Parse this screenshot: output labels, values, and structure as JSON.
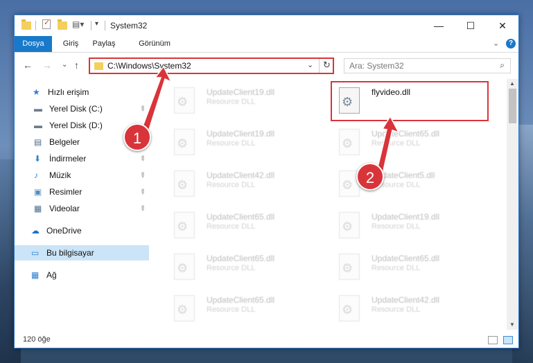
{
  "window": {
    "title": "System32",
    "controls": {
      "minimize": "—",
      "maximize": "☐",
      "close": "✕"
    }
  },
  "ribbon": {
    "tabs": [
      "Dosya",
      "Giriş",
      "Paylaş",
      "Görünüm"
    ],
    "expand_icon": "⌄",
    "help": "?"
  },
  "nav": {
    "back": "←",
    "forward": "→",
    "recent": "⌄",
    "up": "↑",
    "address": "C:\\Windows\\System32",
    "address_dropdown": "⌄",
    "refresh": "↻",
    "search_placeholder": "Ara: System32",
    "search_icon": "⌕"
  },
  "sidebar": {
    "items": [
      {
        "label": "Hızlı erişim",
        "icon": "star-icon",
        "glyph": "★",
        "color": "#2f7fd3"
      },
      {
        "label": "Yerel Disk (C:)",
        "icon": "drive-icon",
        "glyph": "▬",
        "color": "#6b7c8d",
        "pinned": true
      },
      {
        "label": "Yerel Disk (D:)",
        "icon": "drive-icon",
        "glyph": "▬",
        "color": "#6b7c8d"
      },
      {
        "label": "Belgeler",
        "icon": "documents-icon",
        "glyph": "▤",
        "color": "#4f6f8f",
        "pinned": true
      },
      {
        "label": "İndirmeler",
        "icon": "downloads-icon",
        "glyph": "⬇",
        "color": "#2f7fd3",
        "pinned": true
      },
      {
        "label": "Müzik",
        "icon": "music-icon",
        "glyph": "♪",
        "color": "#2f7fd3",
        "pinned": true
      },
      {
        "label": "Resimler",
        "icon": "pictures-icon",
        "glyph": "▣",
        "color": "#4f8fbf",
        "pinned": true
      },
      {
        "label": "Videolar",
        "icon": "videos-icon",
        "glyph": "▦",
        "color": "#4f6f8f",
        "pinned": true
      },
      {
        "label": "OneDrive",
        "icon": "onedrive-icon",
        "glyph": "☁",
        "color": "#1c6fc4"
      },
      {
        "label": "Bu bilgisayar",
        "icon": "computer-icon",
        "glyph": "▭",
        "color": "#2f7fd3",
        "selected": true
      },
      {
        "label": "Ağ",
        "icon": "network-icon",
        "glyph": "▦",
        "color": "#2f7fd3"
      }
    ],
    "pin_glyph": "📌"
  },
  "files": {
    "left": [
      {
        "name": "UpdateClient19.dll",
        "type": "Resource DLL"
      },
      {
        "name": "UpdateClient19.dll",
        "type": "Resource DLL"
      },
      {
        "name": "UpdateClient42.dll",
        "type": "Resource DLL"
      },
      {
        "name": "UpdateClient65.dll",
        "type": "Resource DLL"
      },
      {
        "name": "UpdateClient65.dll",
        "type": "Resource DLL"
      },
      {
        "name": "UpdateClient65.dll",
        "type": "Resource DLL"
      }
    ],
    "right": [
      {
        "name": "flyvideo.dll",
        "type": "",
        "highlighted": true
      },
      {
        "name": "UpdateClient65.dll",
        "type": "Resource DLL"
      },
      {
        "name": "UpdateClient5.dll",
        "type": "Resource DLL"
      },
      {
        "name": "UpdateClient19.dll",
        "type": "Resource DLL"
      },
      {
        "name": "UpdateClient65.dll",
        "type": "Resource DLL"
      },
      {
        "name": "UpdateClient42.dll",
        "type": "Resource DLL"
      }
    ]
  },
  "status": {
    "count": "120 öğe"
  },
  "annotations": {
    "callout1": "1",
    "callout2": "2",
    "color": "#d9343a"
  }
}
